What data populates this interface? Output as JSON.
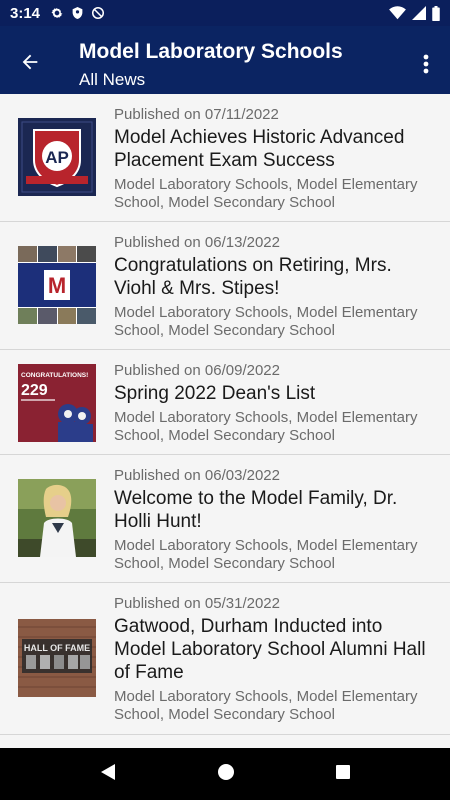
{
  "status_bar": {
    "time": "3:14",
    "left_icons": [
      "gear-icon",
      "shield-icon",
      "at-sign-icon"
    ],
    "right_icons": [
      "wifi-icon",
      "cellular-signal-icon",
      "battery-icon"
    ]
  },
  "app_bar": {
    "title": "Model Laboratory Schools",
    "subtitle": "All News",
    "back_icon": "arrow-left-icon",
    "menu_icon": "more-vertical-icon",
    "color": "#0b2462"
  },
  "news": [
    {
      "date": "Published on 07/11/2022",
      "title": "Model Achieves Historic Advanced Placement Exam Success",
      "schools": "Model Laboratory Schools, Model Elementary School, Model Secondary School",
      "thumb_text": "AP"
    },
    {
      "date": "Published on 06/13/2022",
      "title": "Congratulations on Retiring, Mrs. Viohl & Mrs. Stipes!",
      "schools": "Model Laboratory Schools, Model Elementary School, Model Secondary School",
      "thumb_text": "M"
    },
    {
      "date": "Published on 06/09/2022",
      "title": "Spring 2022 Dean's List",
      "schools": "Model Laboratory Schools, Model Elementary School, Model Secondary School",
      "thumb_text": "CONGRATULATIONS!",
      "thumb_number": "229"
    },
    {
      "date": "Published on 06/03/2022",
      "title": "Welcome to the Model Family, Dr. Holli Hunt!",
      "schools": "Model Laboratory Schools, Model Elementary School, Model Secondary School"
    },
    {
      "date": "Published on 05/31/2022",
      "title": "Gatwood, Durham Inducted into Model Laboratory School Alumni Hall of Fame",
      "schools": "Model Laboratory Schools, Model Elementary School, Model Secondary School",
      "thumb_text": "HALL OF FAME"
    }
  ],
  "nav_bar": {
    "icons": [
      "back-triangle-icon",
      "home-circle-icon",
      "recents-square-icon"
    ]
  }
}
